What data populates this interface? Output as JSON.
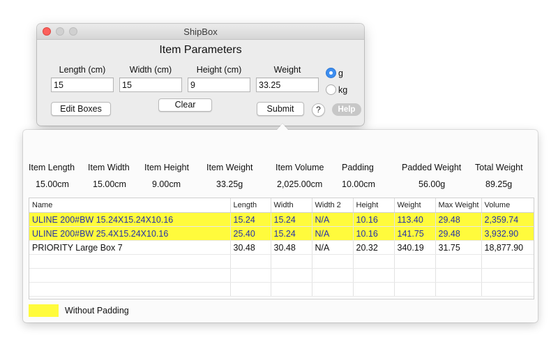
{
  "window": {
    "title": "ShipBox",
    "section_title": "Item Parameters"
  },
  "fields": [
    {
      "label": "Length (cm)",
      "value": "15"
    },
    {
      "label": "Width (cm)",
      "value": "15"
    },
    {
      "label": "Height (cm)",
      "value": "9"
    },
    {
      "label": "Weight",
      "value": "33.25"
    }
  ],
  "units": {
    "options": [
      {
        "label": "g",
        "selected": true
      },
      {
        "label": "kg",
        "selected": false
      }
    ]
  },
  "buttons": {
    "edit_boxes": "Edit Boxes",
    "clear": "Clear",
    "submit": "Submit",
    "question": "?",
    "help": "Help"
  },
  "summary": [
    {
      "label": "Item Length",
      "value": "15.00cm"
    },
    {
      "label": "Item Width",
      "value": "15.00cm"
    },
    {
      "label": "Item Height",
      "value": "9.00cm"
    },
    {
      "label": "Item Weight",
      "value": "33.25g"
    },
    {
      "label": "Item Volume",
      "value": "2,025.00cm"
    },
    {
      "label": "Padding",
      "value": "10.00cm"
    },
    {
      "label": "Padded Weight",
      "value": "56.00g"
    },
    {
      "label": "Total Weight",
      "value": "89.25g"
    }
  ],
  "table": {
    "columns": [
      "Name",
      "Length",
      "Width",
      "Width 2",
      "Height",
      "Weight",
      "Max Weight",
      "Volume"
    ],
    "rows": [
      {
        "highlight": true,
        "cells": [
          "ULINE 200#BW 15.24X15.24X10.16",
          "15.24",
          "15.24",
          "N/A",
          "10.16",
          "113.40",
          "29.48",
          "2,359.74"
        ]
      },
      {
        "highlight": true,
        "cells": [
          "ULINE 200#BW 25.4X15.24X10.16",
          "25.40",
          "15.24",
          "N/A",
          "10.16",
          "141.75",
          "29.48",
          "3,932.90"
        ]
      },
      {
        "highlight": false,
        "cells": [
          "PRIORITY Large Box 7",
          "30.48",
          "30.48",
          "N/A",
          "20.32",
          "340.19",
          "31.75",
          "18,877.90"
        ]
      }
    ],
    "empty_rows": 3
  },
  "legend": {
    "label": "Without Padding",
    "color": "#fffb3c"
  },
  "colors": {
    "highlight_bg": "#fffb3c",
    "highlight_text": "#2632a6",
    "accent": "#3d8ef0",
    "close_button": "#fc605c"
  }
}
